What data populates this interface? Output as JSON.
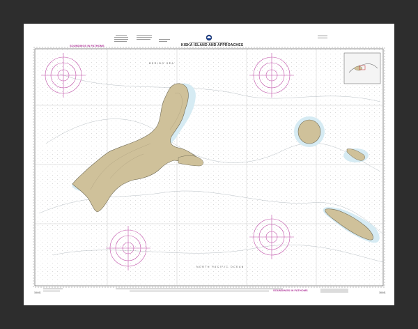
{
  "chart": {
    "title": "KISKA ISLAND AND APPROACHES",
    "soundings_top": "SOUNDINGS IN FATHOMS",
    "soundings_bottom": "SOUNDINGS IN FATHOMS",
    "sea_label": "BERING SEA",
    "ocean_label": "NORTH PACIFIC OCEAN",
    "chart_number_left": "16441",
    "chart_number_right": "16441"
  },
  "colors": {
    "frame": "#2d2d2d",
    "mat": "#ffffff",
    "land": "#cfc19a",
    "shallow_water": "#cfe6f0",
    "compass_rose": "#c050a8",
    "grid": "#b8b8b8"
  }
}
